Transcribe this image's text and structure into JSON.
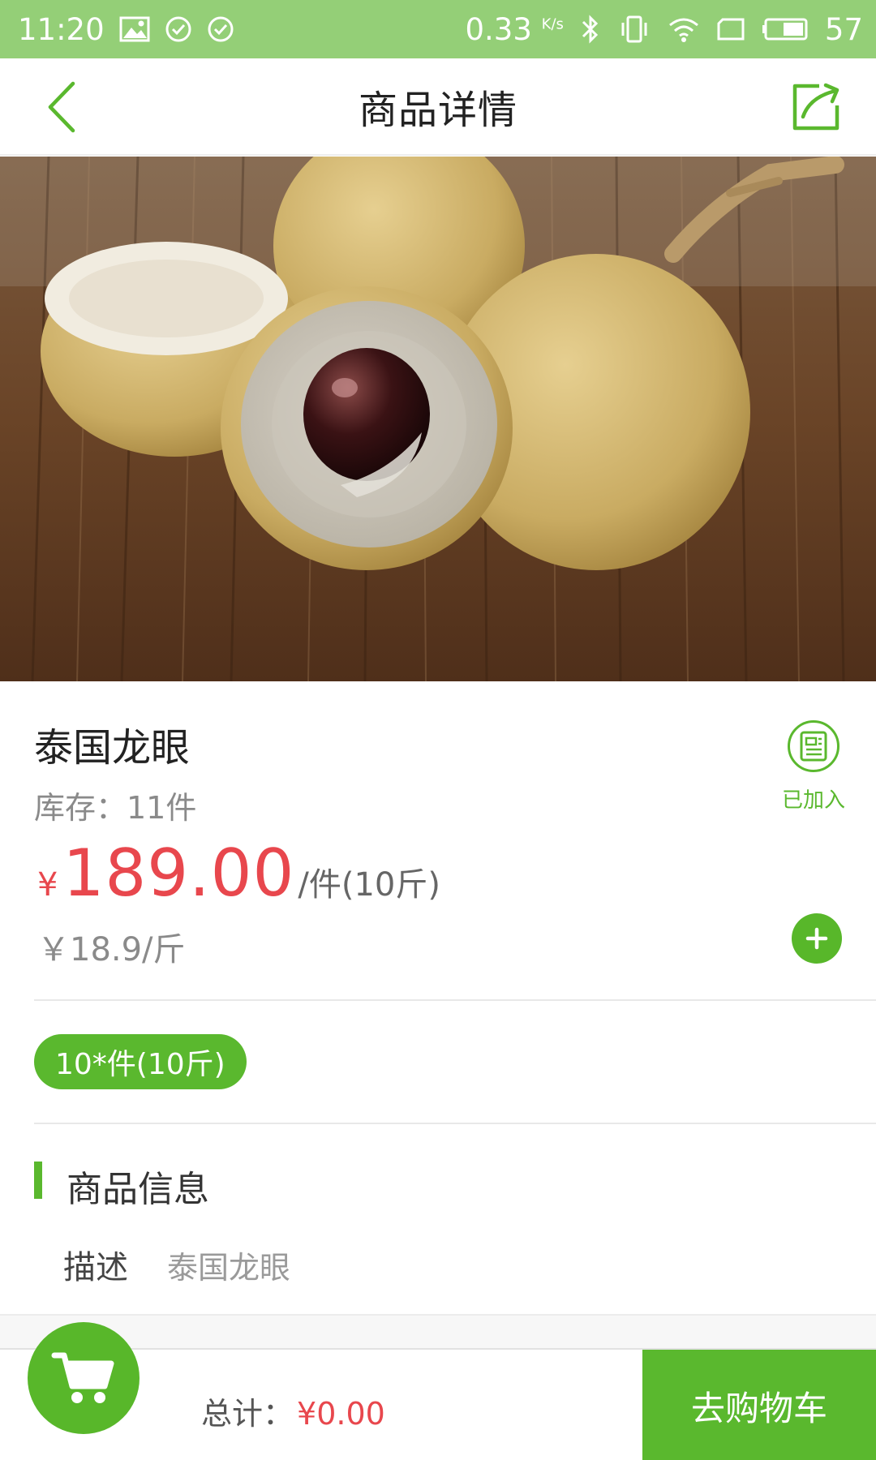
{
  "status_bar": {
    "time": "11:20",
    "net_speed": "0.33",
    "net_speed_unit": "K/s",
    "battery": "57"
  },
  "header": {
    "title": "商品详情",
    "back_icon": "chevron-left-icon",
    "share_icon": "share-icon"
  },
  "product": {
    "name": "泰国龙眼",
    "stock": "库存：11件",
    "price_symbol": "¥",
    "price": "189.00",
    "price_unit": "/件(10斤)",
    "unit_price": "￥18.9/斤",
    "added_label": "已加入"
  },
  "spec": {
    "selected": "10*件(10斤)"
  },
  "info_section": {
    "title": "商品信息",
    "desc_label": "描述",
    "desc_value": "泰国龙眼"
  },
  "bottom_bar": {
    "total_label": "总计：",
    "total_value": "¥0.00",
    "checkout_label": "去购物车"
  },
  "colors": {
    "status_bar": "#94cf77",
    "accent_green": "#5ab82e",
    "price_red": "#e8474d"
  }
}
